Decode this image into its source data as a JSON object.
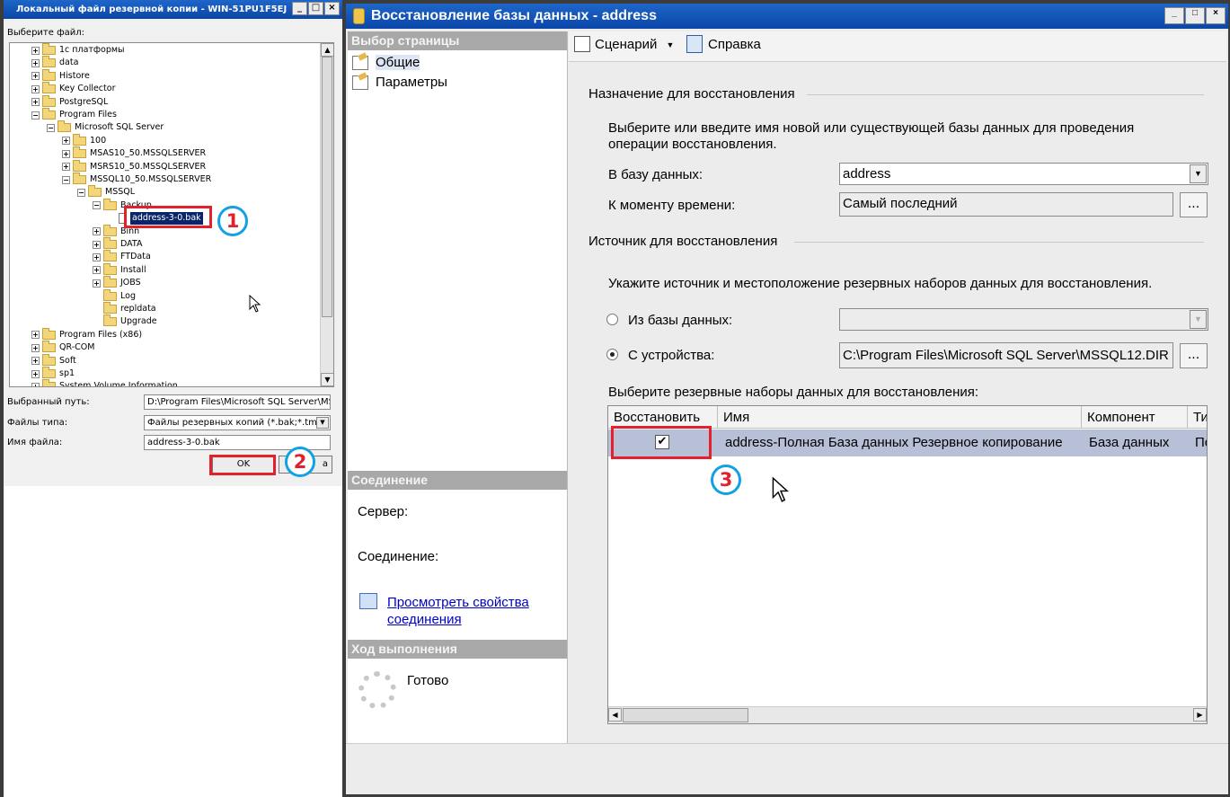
{
  "left_dialog": {
    "title": "Локальный файл резервной копии - WIN-51PU1F5EJ",
    "choose_file_label": "Выберите файл:",
    "tree": [
      {
        "label": "1с платформы",
        "depth": 0,
        "expander": "+",
        "icon": "folder"
      },
      {
        "label": "data",
        "depth": 0,
        "expander": "+",
        "icon": "folder"
      },
      {
        "label": "Histore",
        "depth": 0,
        "expander": "+",
        "icon": "folder"
      },
      {
        "label": "Key Collector",
        "depth": 0,
        "expander": "+",
        "icon": "folder"
      },
      {
        "label": "PostgreSQL",
        "depth": 0,
        "expander": "+",
        "icon": "folder"
      },
      {
        "label": "Program Files",
        "depth": 0,
        "expander": "-",
        "icon": "folder"
      },
      {
        "label": "Microsoft SQL Server",
        "depth": 1,
        "expander": "-",
        "icon": "folder"
      },
      {
        "label": "100",
        "depth": 2,
        "expander": "+",
        "icon": "folder"
      },
      {
        "label": "MSAS10_50.MSSQLSERVER",
        "depth": 2,
        "expander": "+",
        "icon": "folder"
      },
      {
        "label": "MSRS10_50.MSSQLSERVER",
        "depth": 2,
        "expander": "+",
        "icon": "folder"
      },
      {
        "label": "MSSQL10_50.MSSQLSERVER",
        "depth": 2,
        "expander": "-",
        "icon": "folder"
      },
      {
        "label": "MSSQL",
        "depth": 3,
        "expander": "-",
        "icon": "folder"
      },
      {
        "label": "Backup",
        "depth": 4,
        "expander": "-",
        "icon": "folder"
      },
      {
        "label": "address-3-0.bak",
        "depth": 5,
        "expander": "",
        "icon": "file",
        "selected": true
      },
      {
        "label": "Binn",
        "depth": 4,
        "expander": "+",
        "icon": "folder"
      },
      {
        "label": "DATA",
        "depth": 4,
        "expander": "+",
        "icon": "folder"
      },
      {
        "label": "FTData",
        "depth": 4,
        "expander": "+",
        "icon": "folder"
      },
      {
        "label": "Install",
        "depth": 4,
        "expander": "+",
        "icon": "folder"
      },
      {
        "label": "JOBS",
        "depth": 4,
        "expander": "+",
        "icon": "folder"
      },
      {
        "label": "Log",
        "depth": 4,
        "expander": "",
        "icon": "folder"
      },
      {
        "label": "repldata",
        "depth": 4,
        "expander": "",
        "icon": "folder"
      },
      {
        "label": "Upgrade",
        "depth": 4,
        "expander": "",
        "icon": "folder"
      },
      {
        "label": "Program Files (x86)",
        "depth": 0,
        "expander": "+",
        "icon": "folder"
      },
      {
        "label": "QR-COM",
        "depth": 0,
        "expander": "+",
        "icon": "folder"
      },
      {
        "label": "Soft",
        "depth": 0,
        "expander": "+",
        "icon": "folder"
      },
      {
        "label": "sp1",
        "depth": 0,
        "expander": "+",
        "icon": "folder"
      },
      {
        "label": "System Volume Information",
        "depth": 0,
        "expander": "+",
        "icon": "folder"
      }
    ],
    "selected_path_label": "Выбранный путь:",
    "selected_path_value": "D:\\Program Files\\Microsoft SQL Server\\MSSQL",
    "file_type_label": "Файлы типа:",
    "file_type_value": "Файлы резервных копий (*.bak;*.tm)",
    "file_name_label": "Имя файла:",
    "file_name_value": "address-3-0.bak",
    "ok_label": "OK",
    "cancel_label": "а"
  },
  "annotations": {
    "n1": "1",
    "n2": "2",
    "n3": "3"
  },
  "restore_window": {
    "title": "Восстановление базы данных - address",
    "select_page_title": "Выбор страницы",
    "pages": [
      "Общие",
      "Параметры"
    ],
    "toolbar": {
      "script_label": "Сценарий",
      "script_arrow": "▼",
      "help_label": "Справка"
    },
    "connection_title": "Соединение",
    "server_label": "Сервер:",
    "connection_label": "Соединение:",
    "view_conn_link_1": "Просмотреть свойства",
    "view_conn_link_2": "соединения",
    "progress_title": "Ход выполнения",
    "progress_status": "Готово",
    "dest_group": "Назначение для восстановления",
    "dest_desc_1": "Выберите или введите имя новой или существующей базы данных для проведения",
    "dest_desc_2": "операции восстановления.",
    "to_db_label": "В базу данных:",
    "to_db_value": "address",
    "to_time_label": "К моменту времени:",
    "to_time_value": "Самый последний",
    "source_group": "Источник для восстановления",
    "source_desc": "Укажите источник и местоположение резервных наборов данных для восстановления.",
    "from_db_label": "Из базы данных:",
    "from_device_label": "С устройства:",
    "from_device_value": "C:\\Program Files\\Microsoft SQL Server\\MSSQL12.DIR",
    "browse_label": "...",
    "sets_label": "Выберите резервные наборы данных для восстановления:",
    "grid_headers": [
      "Восстановить",
      "Имя",
      "Компонент",
      "Ти"
    ],
    "grid_row": {
      "checked": "✔",
      "name": "address-Полная База данных Резервное копирование",
      "component": "База данных",
      "type": "По"
    }
  },
  "colors": {
    "title_blue": "#0a46a8",
    "annotation_red": "#e3212d",
    "annotation_blue": "#12a1e2",
    "link": "#0000cc"
  }
}
